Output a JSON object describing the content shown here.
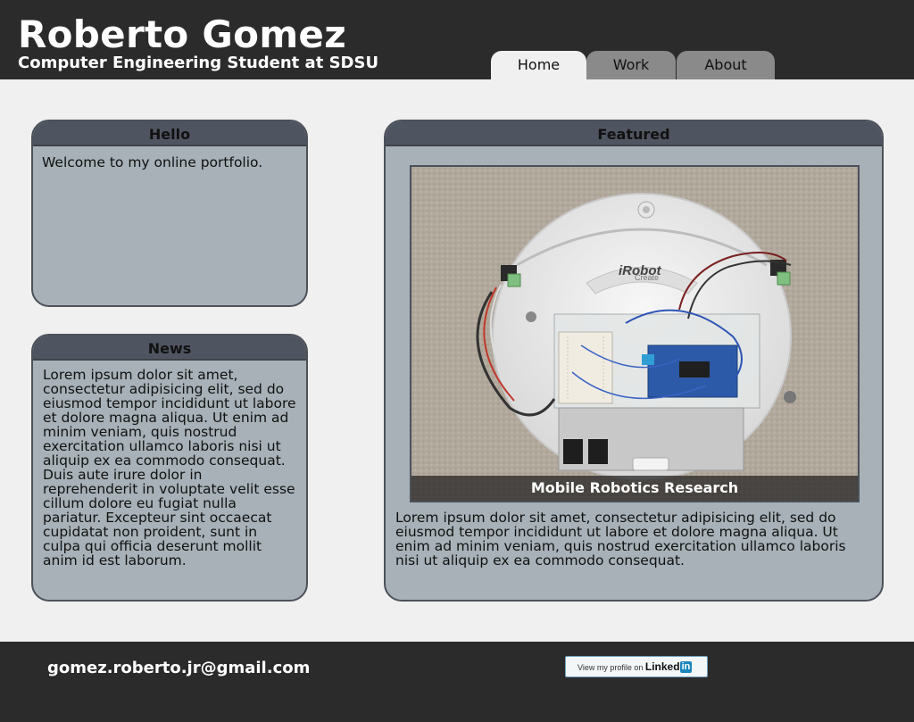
{
  "header": {
    "name": "Roberto Gomez",
    "tagline": "Computer Engineering Student at SDSU"
  },
  "nav": {
    "tabs": [
      {
        "label": "Home",
        "active": true
      },
      {
        "label": "Work",
        "active": false
      },
      {
        "label": "About",
        "active": false
      }
    ]
  },
  "hello": {
    "title": "Hello",
    "text": "Welcome to my online portfolio."
  },
  "news": {
    "title": "News",
    "text": "Lorem ipsum dolor sit amet, consectetur adipisicing elit, sed do eiusmod tempor incididunt ut labore et dolore magna aliqua. Ut enim ad minim veniam, quis nostrud exercitation ullamco laboris nisi ut aliquip ex ea commodo consequat. Duis aute irure dolor in reprehenderit in voluptate velit esse cillum dolore eu fugiat nulla pariatur. Excepteur sint occaecat cupidatat non proident, sunt in culpa qui officia deserunt mollit anim id est laborum."
  },
  "featured": {
    "title": "Featured",
    "caption": "Mobile Robotics Research",
    "photo_brand": "iRobot",
    "photo_model": "Create",
    "text": "Lorem ipsum dolor sit amet, consectetur adipisicing elit, sed do eiusmod tempor incididunt ut labore et dolore magna aliqua. Ut enim ad minim veniam, quis nostrud exercitation ullamco laboris nisi ut aliquip ex ea commodo consequat."
  },
  "footer": {
    "email": "gomez.roberto.jr@gmail.com",
    "linkedin": {
      "prefix": "View my profile on",
      "brand": "Linked",
      "brand_in": "in"
    }
  },
  "colors": {
    "header_bg": "#2b2b2b",
    "panel_bg": "#a7b1b7",
    "panel_head_bg": "#4f5560",
    "tab_inactive": "#8a8a8a",
    "page_bg": "#f0f0f0"
  }
}
